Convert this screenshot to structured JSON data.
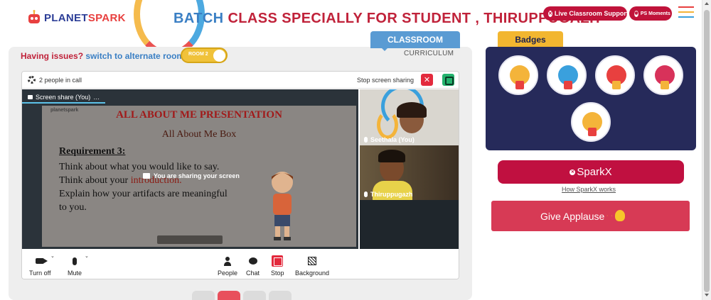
{
  "header": {
    "logo_text_1": "PLANET",
    "logo_text_2": "SPARK",
    "batch_title_prefix": "BATCH ",
    "batch_title_rest": "CLASS SPECIALLY FOR STUDENT , THIRUPPUGAZH",
    "live_support_label": "Live Classroom Support",
    "ps_moments_label": "PS Moments"
  },
  "tabs": {
    "classroom": "CLASSROOM",
    "curriculum": "CURRICULUM"
  },
  "issue": {
    "text": "Having issues?",
    "link": "switch to alternate room",
    "room_toggle": "ROOM 2"
  },
  "call": {
    "people_count": "2 people in call",
    "stop_sharing_label": "Stop screen sharing",
    "screen_tab_label": "Screen share (You)",
    "screen_tab_more": "…",
    "sharing_overlay": "You are sharing your screen",
    "participants": [
      {
        "name": "Seethala (You)"
      },
      {
        "name": "Thiruppugazh"
      }
    ],
    "controls": [
      {
        "label": "Turn off",
        "icon": "camera-icon"
      },
      {
        "label": "Mute",
        "icon": "mic-icon"
      },
      {
        "label": "People",
        "icon": "people-icon"
      },
      {
        "label": "Chat",
        "icon": "chat-icon"
      },
      {
        "label": "Stop",
        "icon": "stop-share-icon"
      },
      {
        "label": "Background",
        "icon": "background-icon"
      }
    ]
  },
  "slide": {
    "logo": "planetspark",
    "title": "ALL ABOUT ME PRESENTATION",
    "subtitle": "All About Me Box",
    "requirement": "Requirement 3:",
    "line1": "Think about what you would like to say.",
    "line2_a": "Think about your ",
    "line2_b": "introduction.",
    "line3": "Explain how your artifacts are meaningful to you."
  },
  "right": {
    "badges_title": "Badges",
    "sparkx_label": "SparkX",
    "how_sparkx": "How SparkX works",
    "applause_label": "Give Applause"
  },
  "colors": {
    "brand_red": "#c0133a",
    "brand_blue": "#3a7fc4",
    "badges_bg": "#262a5a",
    "classroom_tab": "#5a9bd3",
    "badges_tab": "#f2b630",
    "applause": "#d73a55"
  }
}
